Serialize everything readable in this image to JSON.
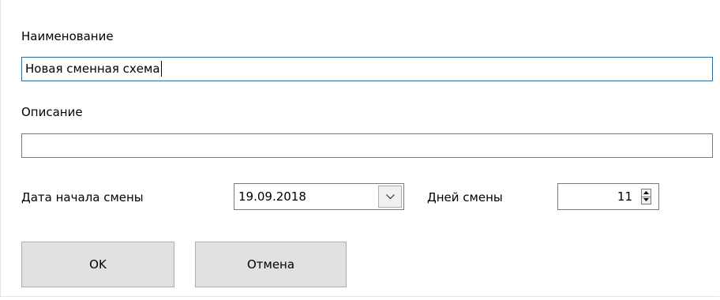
{
  "form": {
    "name_label": "Наименование",
    "name_value": "Новая сменная схема",
    "description_label": "Описание",
    "description_value": "",
    "start_date_label": "Дата начала смены",
    "start_date_value": "19.09.2018",
    "days_label": "Дней смены",
    "days_value": "11"
  },
  "buttons": {
    "ok_label": "OK",
    "cancel_label": "Отмена"
  },
  "icons": {
    "date_dropdown": "chevron-down-icon",
    "spin_up": "spin-up-arrow-icon",
    "spin_down": "spin-down-arrow-icon"
  },
  "colors": {
    "focus_border": "#0078d7",
    "input_border": "#7a7a7a",
    "button_face": "#e1e1e1",
    "button_border": "#adadad"
  }
}
